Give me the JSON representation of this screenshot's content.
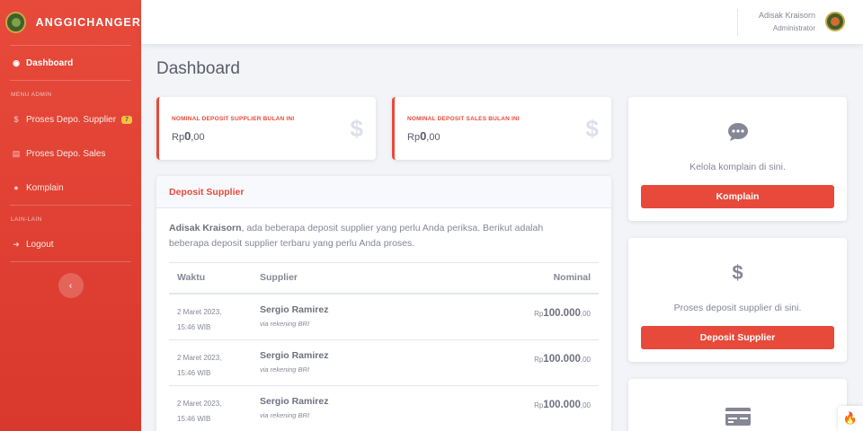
{
  "brand": {
    "name": "ANGGICHANGER"
  },
  "sidebar": {
    "dashboard": "Dashboard",
    "heading_admin": "MENU ADMIN",
    "items_admin": [
      {
        "label": "Proses Depo. Supplier",
        "icon": "dollar-icon",
        "badge": "7"
      },
      {
        "label": "Proses Depo. Sales",
        "icon": "card-icon"
      },
      {
        "label": "Komplain",
        "icon": "comment-icon"
      }
    ],
    "heading_other": "LAIN-LAIN",
    "logout": "Logout"
  },
  "topbar": {
    "user_name": "Adisak Kraisorn",
    "user_role": "Administrator"
  },
  "page": {
    "title": "Dashboard"
  },
  "stats": [
    {
      "label": "NOMINAL DEPOSIT SUPPLIER BULAN INI",
      "prefix": "Rp",
      "value": "0",
      "decimal": ",00"
    },
    {
      "label": "NOMINAL DEPOSIT SALES BULAN INI",
      "prefix": "Rp",
      "value": "0",
      "decimal": ",00"
    }
  ],
  "deposit_supplier": {
    "title": "Deposit Supplier",
    "intro_name": "Adisak Kraisorn",
    "intro_text": ", ada beberapa deposit supplier yang perlu Anda periksa. Berikut adalah beberapa deposit supplier terbaru yang perlu Anda proses.",
    "columns": [
      "Waktu",
      "Supplier",
      "Nominal"
    ],
    "rows": [
      {
        "date": "2 Maret 2023,",
        "time": "15:46 WIB",
        "supplier": "Sergio Ramirez",
        "via": "via rekening BRI",
        "currency": "Rp",
        "amount": "100.000",
        "decimal": ",00"
      },
      {
        "date": "2 Maret 2023,",
        "time": "15:46 WIB",
        "supplier": "Sergio Ramirez",
        "via": "via rekening BRI",
        "currency": "Rp",
        "amount": "100.000",
        "decimal": ",00"
      },
      {
        "date": "2 Maret 2023,",
        "time": "15:46 WIB",
        "supplier": "Sergio Ramirez",
        "via": "via rekening BRI",
        "currency": "Rp",
        "amount": "100.000",
        "decimal": ",00"
      }
    ]
  },
  "side_cards": [
    {
      "icon": "comment-icon",
      "text": "Kelola komplain di sini.",
      "button": "Komplain"
    },
    {
      "icon": "dollar-icon",
      "text": "Proses deposit supplier di sini.",
      "button": "Deposit Supplier"
    },
    {
      "icon": "card-icon"
    }
  ],
  "colors": {
    "primary": "#e74a3b",
    "badge": "#f6c23e",
    "background": "#f3f4f8"
  }
}
